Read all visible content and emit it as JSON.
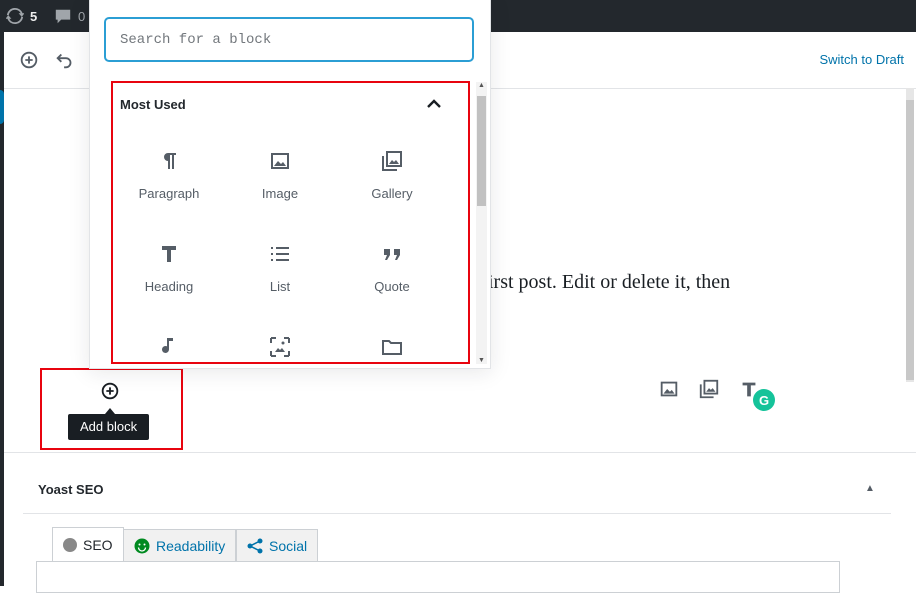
{
  "admin_bar": {
    "updates_count": "5",
    "comments_count": "0",
    "updates_icon": "refresh-icon",
    "comments_icon": "comment-bubble-icon"
  },
  "toolbar": {
    "add_icon": "plus-circle-icon",
    "undo_icon": "undo-icon",
    "switch_to_draft": "Switch to Draft"
  },
  "inserter": {
    "search_placeholder": "Search for a block",
    "panel_title": "Most Used",
    "panel_toggle_icon": "chevron-up-icon",
    "blocks": [
      {
        "label": "Paragraph",
        "icon": "paragraph-icon"
      },
      {
        "label": "Image",
        "icon": "image-icon"
      },
      {
        "label": "Gallery",
        "icon": "gallery-icon"
      },
      {
        "label": "Heading",
        "icon": "heading-icon"
      },
      {
        "label": "List",
        "icon": "list-icon"
      },
      {
        "label": "Quote",
        "icon": "quote-icon"
      },
      {
        "label": "",
        "icon": "audio-icon"
      },
      {
        "label": "",
        "icon": "cover-image-icon"
      },
      {
        "label": "",
        "icon": "folder-icon"
      }
    ]
  },
  "editor": {
    "post_text": "irst post. Edit or delete it, then",
    "side_icons": [
      "image-icon",
      "gallery-icon",
      "heading-icon"
    ],
    "grammarly_letter": "G"
  },
  "add_block": {
    "tooltip": "Add block",
    "icon": "plus-circle-icon"
  },
  "yoast": {
    "title": "Yoast SEO",
    "toggle_icon": "triangle-up-icon",
    "tabs": [
      {
        "label": "SEO",
        "icon": "grey-circle-icon",
        "active": true
      },
      {
        "label": "Readability",
        "icon": "smiley-icon",
        "active": false
      },
      {
        "label": "Social",
        "icon": "share-icon",
        "active": false
      }
    ]
  },
  "colors": {
    "accent": "#0073aa",
    "highlight_red": "#e8040f",
    "admin_bar": "#23282d",
    "focus_blue": "#2b9ed4",
    "grammarly_green": "#15c39a",
    "readability_green": "#008a20"
  }
}
